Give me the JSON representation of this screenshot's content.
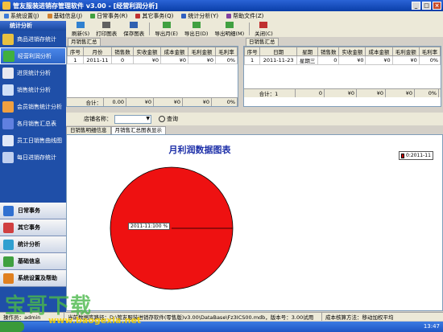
{
  "window": {
    "title": "管友服装进销存管理软件 v3.00 - [经营利润分析]"
  },
  "menu": [
    {
      "label": "系统设置(J)",
      "color": "#3c7ad8"
    },
    {
      "label": "基础信息(J)",
      "color": "#d08030"
    },
    {
      "label": "日常事务(R)",
      "color": "#40a040"
    },
    {
      "label": "其它事务(Q)",
      "color": "#c03030"
    },
    {
      "label": "统计分析(Y)",
      "color": "#3060c0"
    },
    {
      "label": "帮助文件(Z)",
      "color": "#8040a0"
    }
  ],
  "sidebar": {
    "header": "统计分析",
    "items": [
      {
        "label": "商品进销存统计",
        "icon": "box-icon",
        "color": "#e8c040"
      },
      {
        "label": "经营利润分析",
        "icon": "money-icon",
        "color": "#40b040",
        "active": true
      },
      {
        "label": "进货统计分析",
        "icon": "chart-icon",
        "color": "#e8e8f0"
      },
      {
        "label": "销售统计分析",
        "icon": "chart-icon",
        "color": "#d0e0f8"
      },
      {
        "label": "会员销售统计分析",
        "icon": "members-icon",
        "color": "#f0a040"
      },
      {
        "label": "各月销售汇总表",
        "icon": "calendar-icon",
        "color": "#6080e0"
      },
      {
        "label": "员工日销售曲线图",
        "icon": "employee-icon",
        "color": "#e0e8f8"
      },
      {
        "label": "每日进销存统计",
        "icon": "daily-icon",
        "color": "#c0d0f0"
      }
    ],
    "groups": [
      {
        "label": "日常事务",
        "color": "#3070d0"
      },
      {
        "label": "其它事务",
        "color": "#d04040"
      },
      {
        "label": "统计分析",
        "color": "#30a0d0"
      },
      {
        "label": "基础信息",
        "color": "#40a040"
      },
      {
        "label": "系统设置及帮助",
        "color": "#e08020"
      }
    ]
  },
  "toolbar": {
    "buttons": [
      {
        "label": "刷新(S)",
        "icon": "refresh-icon",
        "color": "#3080d0"
      },
      {
        "label": "打印图表",
        "icon": "print-icon",
        "color": "#606060"
      },
      {
        "label": "保存图表",
        "icon": "save-icon",
        "color": "#3060b0"
      },
      {
        "label": "导出月(E)",
        "icon": "export-icon",
        "color": "#40a040"
      },
      {
        "label": "导出日(D)",
        "icon": "export-icon",
        "color": "#40a040"
      },
      {
        "label": "导出明细(M)",
        "icon": "export-icon",
        "color": "#40a040"
      },
      {
        "label": "关闭(C)",
        "icon": "close-icon",
        "color": "#c03030"
      }
    ]
  },
  "monthly": {
    "tab": "月销售汇总",
    "columns": [
      "序号",
      "月份",
      "销售数",
      "实收金额",
      "成本金额",
      "毛利金额",
      "毛利率"
    ],
    "rows": [
      [
        "1",
        "2011-11",
        "0",
        "¥0",
        "¥0",
        "¥0",
        "0%"
      ]
    ],
    "footer": [
      "合计：",
      "0.00",
      "¥0",
      "¥0",
      "¥0",
      "0%"
    ]
  },
  "daily": {
    "tab": "日销售汇总",
    "columns": [
      "序号",
      "日期",
      "星期",
      "销售数",
      "实收金额",
      "成本金额",
      "毛利金额",
      "毛利率"
    ],
    "rows": [
      [
        "1",
        "2011-11-23",
        "星期三",
        "0",
        "¥0",
        "¥0",
        "¥0",
        "0%"
      ]
    ],
    "footer": [
      "合计：1",
      "0",
      "¥0",
      "¥0",
      "¥0",
      "0%"
    ]
  },
  "search": {
    "label": "店铺名称：",
    "button": "查询"
  },
  "tabs": [
    "日销售明细信息",
    "月销售汇总图表显示"
  ],
  "chart_data": {
    "type": "pie",
    "title": "月利润数据图表",
    "slices": [
      {
        "label": "2011-11",
        "value": 100,
        "color": "#ee1111"
      }
    ],
    "data_label": "2011-11:100 %",
    "legend": {
      "entries": [
        "0:2011-11"
      ],
      "placement": "top-right"
    }
  },
  "status": {
    "user": "操作员：admin",
    "db": "当前数据库路径：D:\\管友服装进销存软件(零售版)v3.00\\DataBase\\Fz3ICS00.mdb，版本号：3.00试用",
    "cost": "成本核算方法：移动加权平均"
  },
  "taskbar": {
    "clock": "13:47"
  },
  "watermark": {
    "main": "宝哥下载",
    "sub": "www.baogexia.net"
  }
}
